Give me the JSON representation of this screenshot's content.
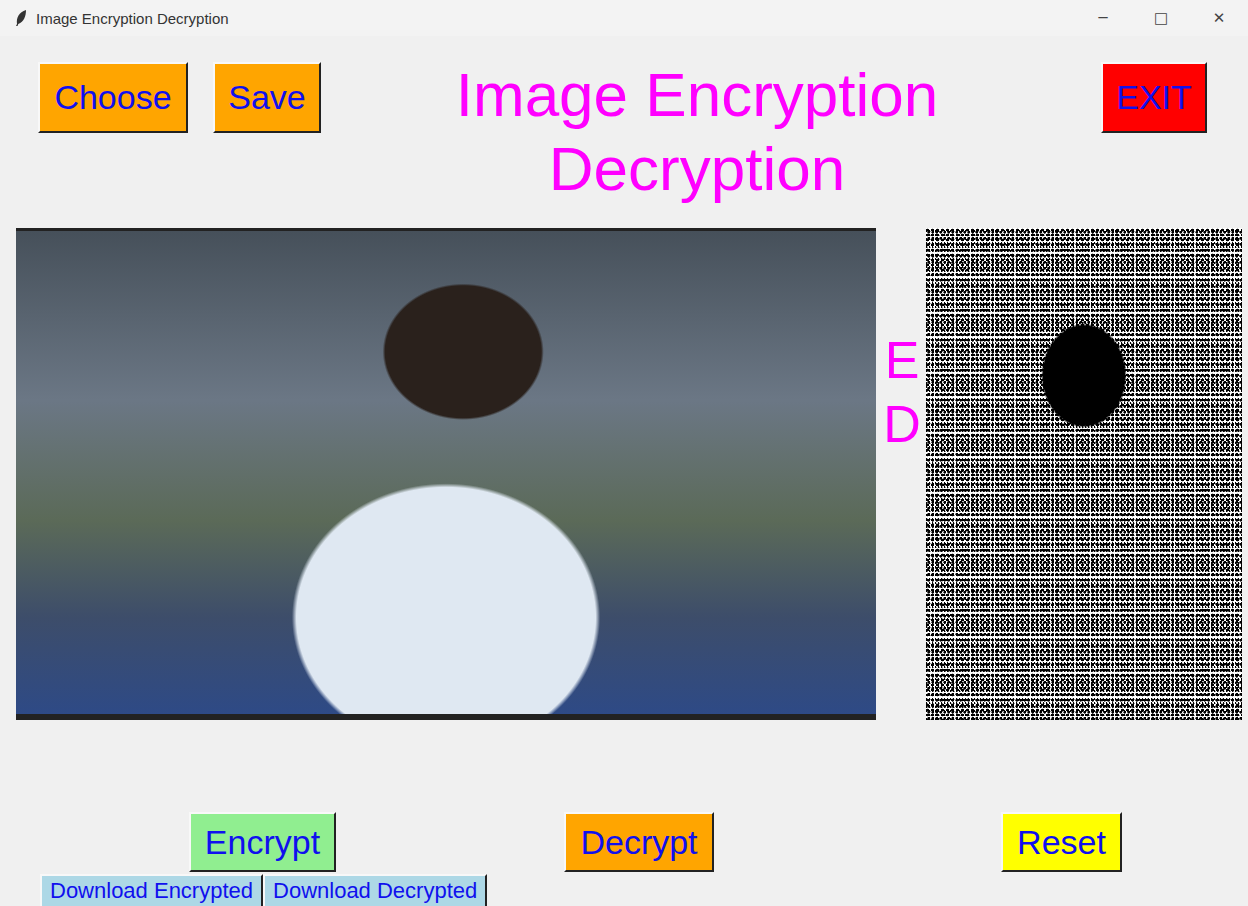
{
  "window": {
    "title": "Image Encryption Decryption",
    "controls": [
      "─",
      "□",
      "✕"
    ]
  },
  "toolbar": {
    "buttons": [
      "Choose",
      "Save"
    ]
  },
  "heading": {
    "lines": [
      "Image Encryption",
      "Decryption"
    ]
  },
  "exit_button": "EXIT",
  "hidden_label": {
    "lines": [
      "E",
      "D"
    ]
  },
  "actions": [
    {
      "label": "Encrypt",
      "color": "#90ee90"
    },
    {
      "label": "Decrypt",
      "color": "#ffa500"
    },
    {
      "label": "Reset",
      "color": "#ffff00"
    }
  ],
  "downloads": [
    "Download Encrypted",
    "Download Decrypted"
  ]
}
